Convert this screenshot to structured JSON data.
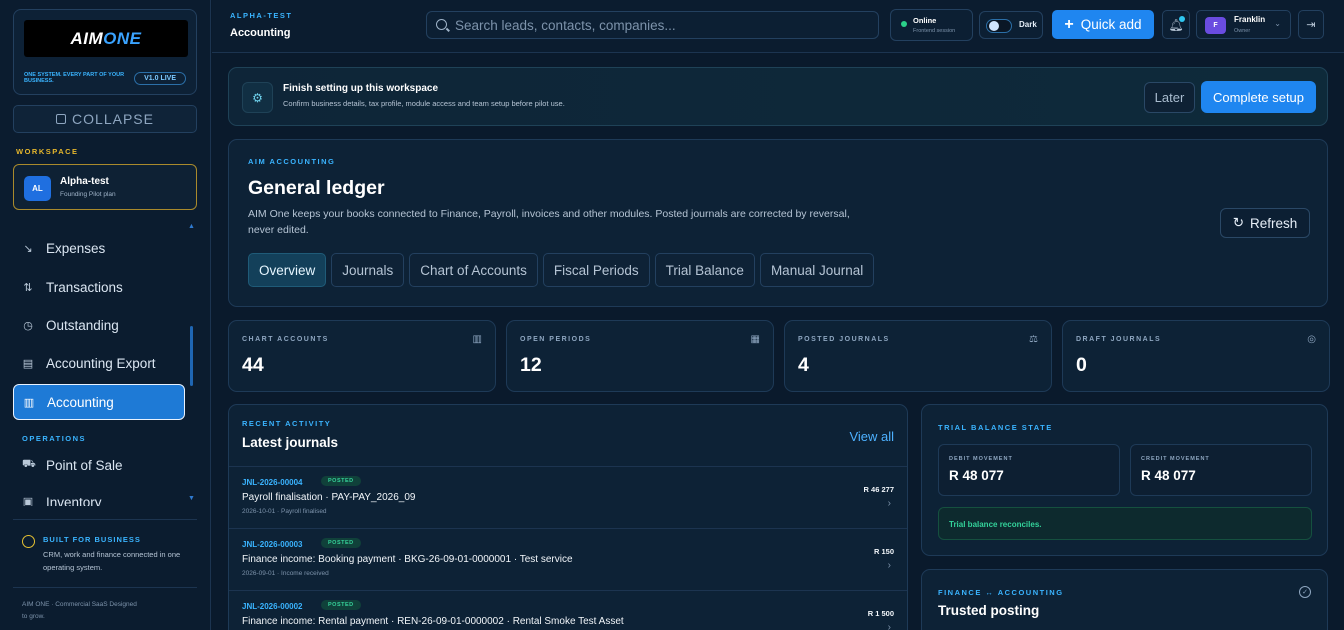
{
  "brand": {
    "logo_text_a": "AIM",
    "logo_text_b": "ONE",
    "tagline": "ONE SYSTEM. EVERY PART OF YOUR BUSINESS.",
    "version": "V1.0 LIVE"
  },
  "sidebar": {
    "collapse_label": "COLLAPSE",
    "workspace_label": "WORKSPACE",
    "workspace": {
      "initials": "AL",
      "name": "Alpha-test",
      "plan": "Founding Pilot plan"
    },
    "items": [
      {
        "label": "Expenses",
        "icon": "trending-down-icon"
      },
      {
        "label": "Transactions",
        "icon": "arrows-updown-icon"
      },
      {
        "label": "Outstanding",
        "icon": "clock-icon"
      },
      {
        "label": "Accounting Export",
        "icon": "file-icon"
      },
      {
        "label": "Accounting",
        "icon": "book-icon",
        "active": true
      }
    ],
    "operations_label": "OPERATIONS",
    "operations_items": [
      {
        "label": "Point of Sale",
        "icon": "cart-icon"
      },
      {
        "label": "Inventory",
        "icon": "box-icon"
      }
    ],
    "built_title": "BUILT FOR BUSINESS",
    "built_text": "CRM, work and finance connected in one operating system.",
    "copyright": "AIM ONE · Commercial SaaS Designed to grow."
  },
  "topbar": {
    "crumb_small": "ALPHA-TEST",
    "crumb_title": "Accounting",
    "search_placeholder": "Search leads, contacts, companies...",
    "status_title": "Online",
    "status_sub": "Frontend session",
    "theme_label": "Dark",
    "quick_add": "Quick add",
    "user": {
      "initial": "F",
      "name": "Franklin",
      "role": "Owner"
    }
  },
  "setup": {
    "title": "Finish setting up this workspace",
    "subtitle": "Confirm business details, tax profile, module access and team setup before pilot use.",
    "later": "Later",
    "complete": "Complete setup"
  },
  "ledger": {
    "eyebrow": "AIM ACCOUNTING",
    "title": "General ledger",
    "description": "AIM One keeps your books connected to Finance, Payroll, invoices and other modules. Posted journals are corrected by reversal, never edited.",
    "refresh": "Refresh",
    "tabs": [
      "Overview",
      "Journals",
      "Chart of Accounts",
      "Fiscal Periods",
      "Trial Balance",
      "Manual Journal"
    ],
    "active_tab": 0
  },
  "stats": [
    {
      "label": "CHART ACCOUNTS",
      "value": "44",
      "icon": "book-icon"
    },
    {
      "label": "OPEN PERIODS",
      "value": "12",
      "icon": "calendar-icon"
    },
    {
      "label": "POSTED JOURNALS",
      "value": "4",
      "icon": "scale-icon"
    },
    {
      "label": "DRAFT JOURNALS",
      "value": "0",
      "icon": "check-circle-icon"
    }
  ],
  "activity": {
    "eyebrow": "RECENT ACTIVITY",
    "title": "Latest journals",
    "view_all": "View all",
    "journals": [
      {
        "id": "JNL-2026-00004",
        "status": "POSTED",
        "title": "Payroll finalisation · PAY-PAY_2026_09",
        "meta": "2026-10-01 · Payroll finalised",
        "amount": "R 46 277"
      },
      {
        "id": "JNL-2026-00003",
        "status": "POSTED",
        "title": "Finance income: Booking payment · BKG-26-09-01-0000001 · Test service",
        "meta": "2026-09-01 · Income received",
        "amount": "R 150"
      },
      {
        "id": "JNL-2026-00002",
        "status": "POSTED",
        "title": "Finance income: Rental payment · REN-26-09-01-0000002 · Rental Smoke Test Asset",
        "meta": "",
        "amount": "R 1 500"
      }
    ]
  },
  "trial": {
    "eyebrow": "TRIAL BALANCE STATE",
    "debit_label": "DEBIT MOVEMENT",
    "debit_value": "R 48 077",
    "credit_label": "CREDIT MOVEMENT",
    "credit_value": "R 48 077",
    "reconcile": "Trial balance reconciles."
  },
  "trusted": {
    "eyebrow": "FINANCE ↔ ACCOUNTING",
    "title": "Trusted posting"
  }
}
